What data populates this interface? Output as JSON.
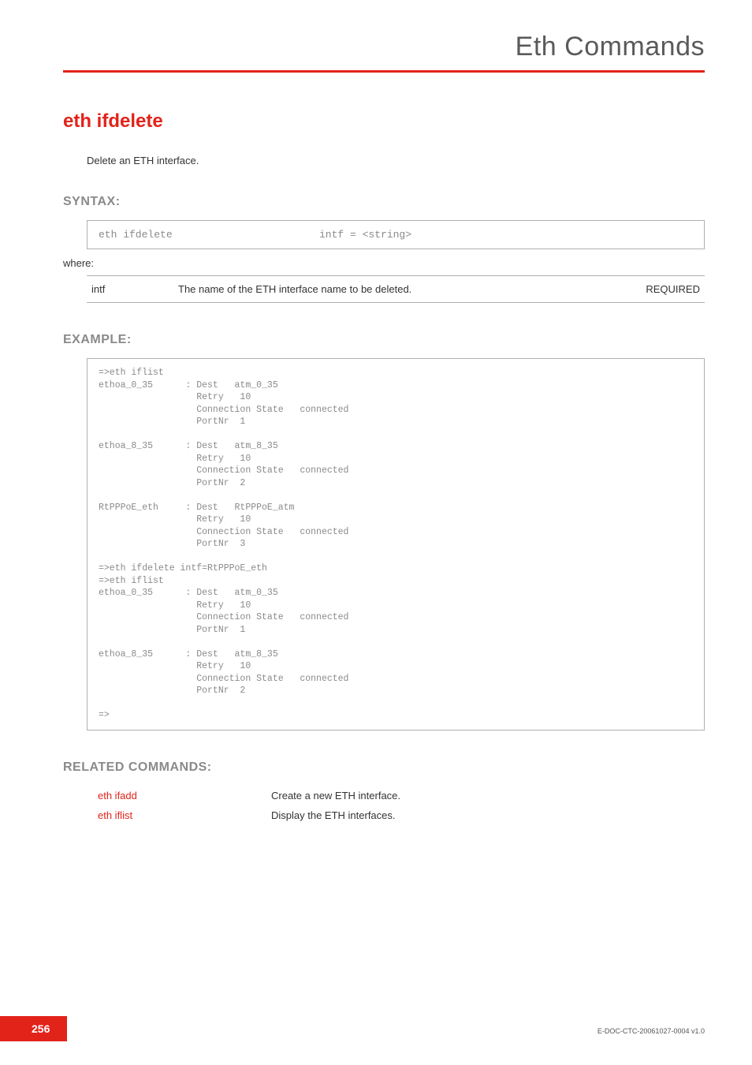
{
  "chapter": "Eth Commands",
  "command": {
    "title": "eth ifdelete",
    "description": "Delete an ETH interface."
  },
  "syntax": {
    "heading": "SYNTAX:",
    "cmd": "eth ifdelete",
    "params": "intf = <string>",
    "where": "where:",
    "table": [
      {
        "name": "intf",
        "desc": "The name of the ETH interface name to be deleted.",
        "req": "REQUIRED"
      }
    ]
  },
  "example": {
    "heading": "EXAMPLE:",
    "text": "=>eth iflist\nethoa_0_35      : Dest   atm_0_35\n                  Retry   10\n                  Connection State   connected\n                  PortNr  1\n\nethoa_8_35      : Dest   atm_8_35\n                  Retry   10\n                  Connection State   connected\n                  PortNr  2\n\nRtPPPoE_eth     : Dest   RtPPPoE_atm\n                  Retry   10\n                  Connection State   connected\n                  PortNr  3\n\n=>eth ifdelete intf=RtPPPoE_eth\n=>eth iflist\nethoa_0_35      : Dest   atm_0_35\n                  Retry   10\n                  Connection State   connected\n                  PortNr  1\n\nethoa_8_35      : Dest   atm_8_35\n                  Retry   10\n                  Connection State   connected\n                  PortNr  2\n\n=>"
  },
  "related": {
    "heading": "RELATED COMMANDS:",
    "rows": [
      {
        "cmd": "eth ifadd",
        "desc": "Create a new ETH interface."
      },
      {
        "cmd": "eth iflist",
        "desc": "Display the ETH interfaces."
      }
    ]
  },
  "footer": {
    "page": "256",
    "docid": "E-DOC-CTC-20061027-0004 v1.0"
  }
}
